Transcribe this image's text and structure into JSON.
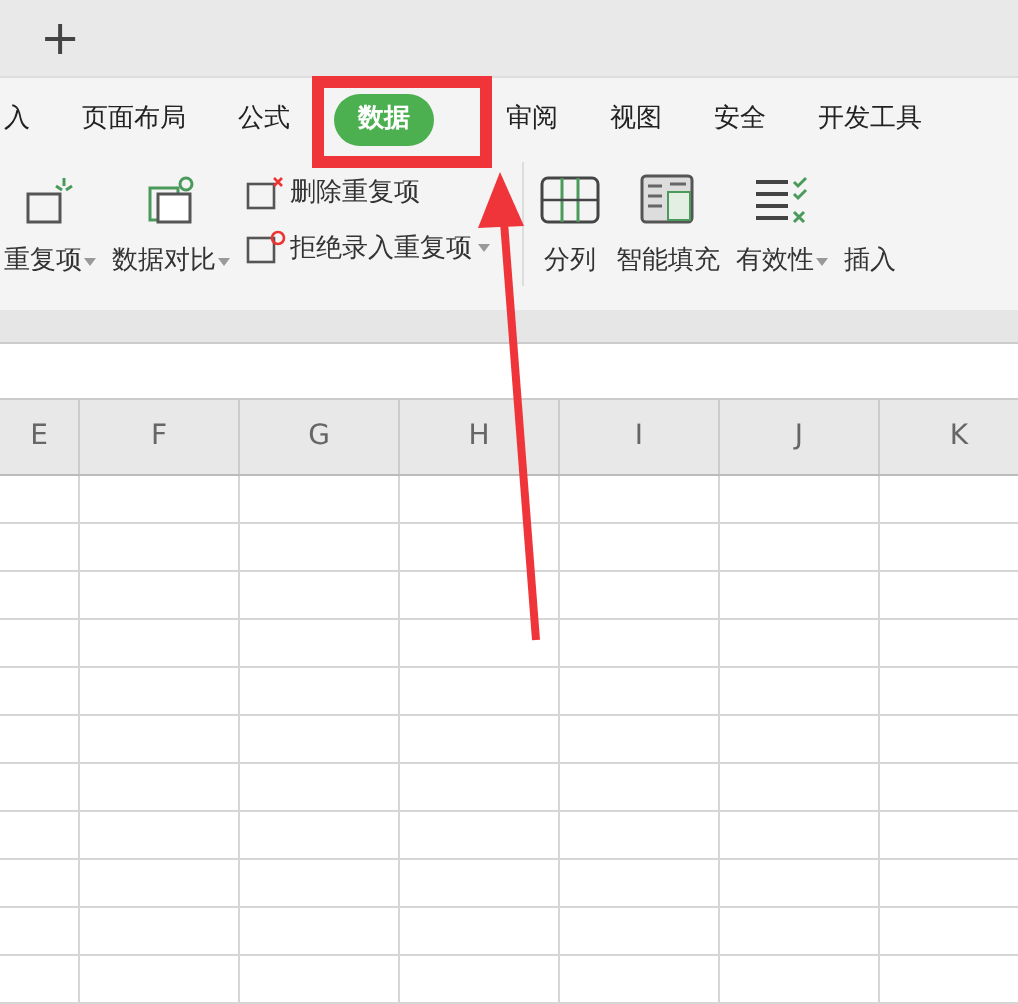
{
  "tab_bar": {
    "new_tab": "+"
  },
  "menu_tabs": [
    {
      "label": "入",
      "selected": false
    },
    {
      "label": "页面布局",
      "selected": false
    },
    {
      "label": "公式",
      "selected": false
    },
    {
      "label": "数据",
      "selected": true
    },
    {
      "label": "审阅",
      "selected": false
    },
    {
      "label": "视图",
      "selected": false
    },
    {
      "label": "安全",
      "selected": false
    },
    {
      "label": "开发工具",
      "selected": false
    }
  ],
  "ribbon": [
    {
      "kind": "large",
      "label": "重复项",
      "dropdown": true
    },
    {
      "kind": "large",
      "label": "数据对比",
      "dropdown": true
    },
    {
      "kind": "stack",
      "items": [
        {
          "label": "删除重复项",
          "dropdown": false
        },
        {
          "label": "拒绝录入重复项",
          "dropdown": true
        }
      ]
    },
    {
      "kind": "divider"
    },
    {
      "kind": "large",
      "label": "分列",
      "dropdown": false
    },
    {
      "kind": "large",
      "label": "智能填充",
      "dropdown": false
    },
    {
      "kind": "large",
      "label": "有效性",
      "dropdown": true
    },
    {
      "kind": "large",
      "label": "插入",
      "dropdown": false
    }
  ],
  "sheet": {
    "columns": [
      "E",
      "F",
      "G",
      "H",
      "I",
      "J",
      "K"
    ]
  }
}
